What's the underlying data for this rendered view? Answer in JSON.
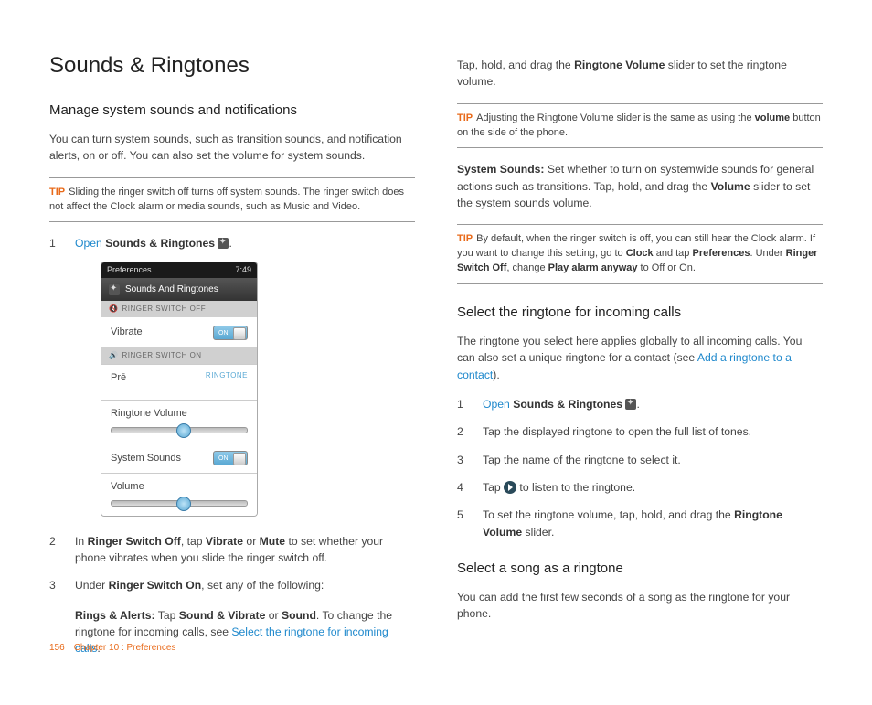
{
  "title": "Sounds & Ringtones",
  "left": {
    "h2": "Manage system sounds and notifications",
    "intro": "You can turn system sounds, such as transition sounds, and notification alerts, on or off. You can also set the volume for system sounds.",
    "tip1_label": "TIP",
    "tip1": "Sliding the ringer switch off turns off system sounds. The ringer switch does not affect the Clock alarm or media sounds, such as Music and Video.",
    "step1_open": "Open",
    "step1_bold": "Sounds & Ringtones",
    "step1_tail": ".",
    "phone": {
      "status_left": "Preferences",
      "status_right": "7:49",
      "title": "Sounds And Ringtones",
      "section_off": "RINGER SWITCH OFF",
      "row_vibrate": "Vibrate",
      "toggle_on": "ON",
      "section_on": "RINGER SWITCH ON",
      "row_pre": "Prē",
      "row_pre_right": "RINGTONE",
      "row_ringtone_vol": "Ringtone Volume",
      "row_system_sounds": "System Sounds",
      "row_volume": "Volume"
    },
    "step2_pre": "In ",
    "step2_b1": "Ringer Switch Off",
    "step2_mid": ", tap ",
    "step2_b2": "Vibrate",
    "step2_or": " or ",
    "step2_b3": "Mute",
    "step2_end": " to set whether your phone vibrates when you slide the ringer switch off.",
    "step3_pre": "Under ",
    "step3_b1": "Ringer Switch On",
    "step3_end": ", set any of the following:",
    "rings_b1": "Rings & Alerts:",
    "rings_mid1": " Tap ",
    "rings_b2": "Sound & Vibrate",
    "rings_or": " or ",
    "rings_b3": "Sound",
    "rings_mid2": ". To change the ringtone for incoming calls, see ",
    "rings_link": "Select the ringtone for incoming calls",
    "rings_tail": "."
  },
  "right": {
    "top_pre": "Tap, hold, and drag the ",
    "top_b": "Ringtone Volume",
    "top_end": " slider to set the ringtone volume.",
    "tip2_label": "TIP",
    "tip2_pre": "Adjusting the Ringtone Volume slider is the same as using the ",
    "tip2_b": "volume",
    "tip2_end": " button on the side of the phone.",
    "sys_b": "System Sounds:",
    "sys_mid": " Set whether to turn on systemwide sounds for general actions such as transitions. Tap, hold, and drag the ",
    "sys_b2": "Volume",
    "sys_end": " slider to set the system sounds volume.",
    "tip3_label": "TIP",
    "tip3_a": "By default, when the ringer switch is off, you can still hear the Clock alarm. If you want to change this setting, go to ",
    "tip3_b1": "Clock",
    "tip3_b": " and tap ",
    "tip3_b2": "Preferences",
    "tip3_c": ". Under ",
    "tip3_b3": "Ringer Switch Off",
    "tip3_d": ", change ",
    "tip3_b4": "Play alarm anyway",
    "tip3_e": " to Off or On.",
    "h2b": "Select the ringtone for incoming calls",
    "p2_a": "The ringtone you select here applies globally to all incoming calls. You can also set a unique ringtone for a contact (see ",
    "p2_link": "Add a ringtone to a contact",
    "p2_b": ").",
    "s1_open": "Open",
    "s1_bold": "Sounds & Ringtones",
    "s1_tail": ".",
    "s2": "Tap the displayed ringtone to open the full list of tones.",
    "s3": "Tap the name of the ringtone to select it.",
    "s4_a": "Tap ",
    "s4_b": " to listen to the ringtone.",
    "s5_a": "To set the ringtone volume, tap, hold, and drag the ",
    "s5_b": "Ringtone Volume",
    "s5_c": " slider.",
    "h2c": "Select a song as a ringtone",
    "p3": "You can add the first few seconds of a song as the ringtone for your phone."
  },
  "footer": {
    "page": "156",
    "crumb": "Chapter 10 : Preferences"
  }
}
